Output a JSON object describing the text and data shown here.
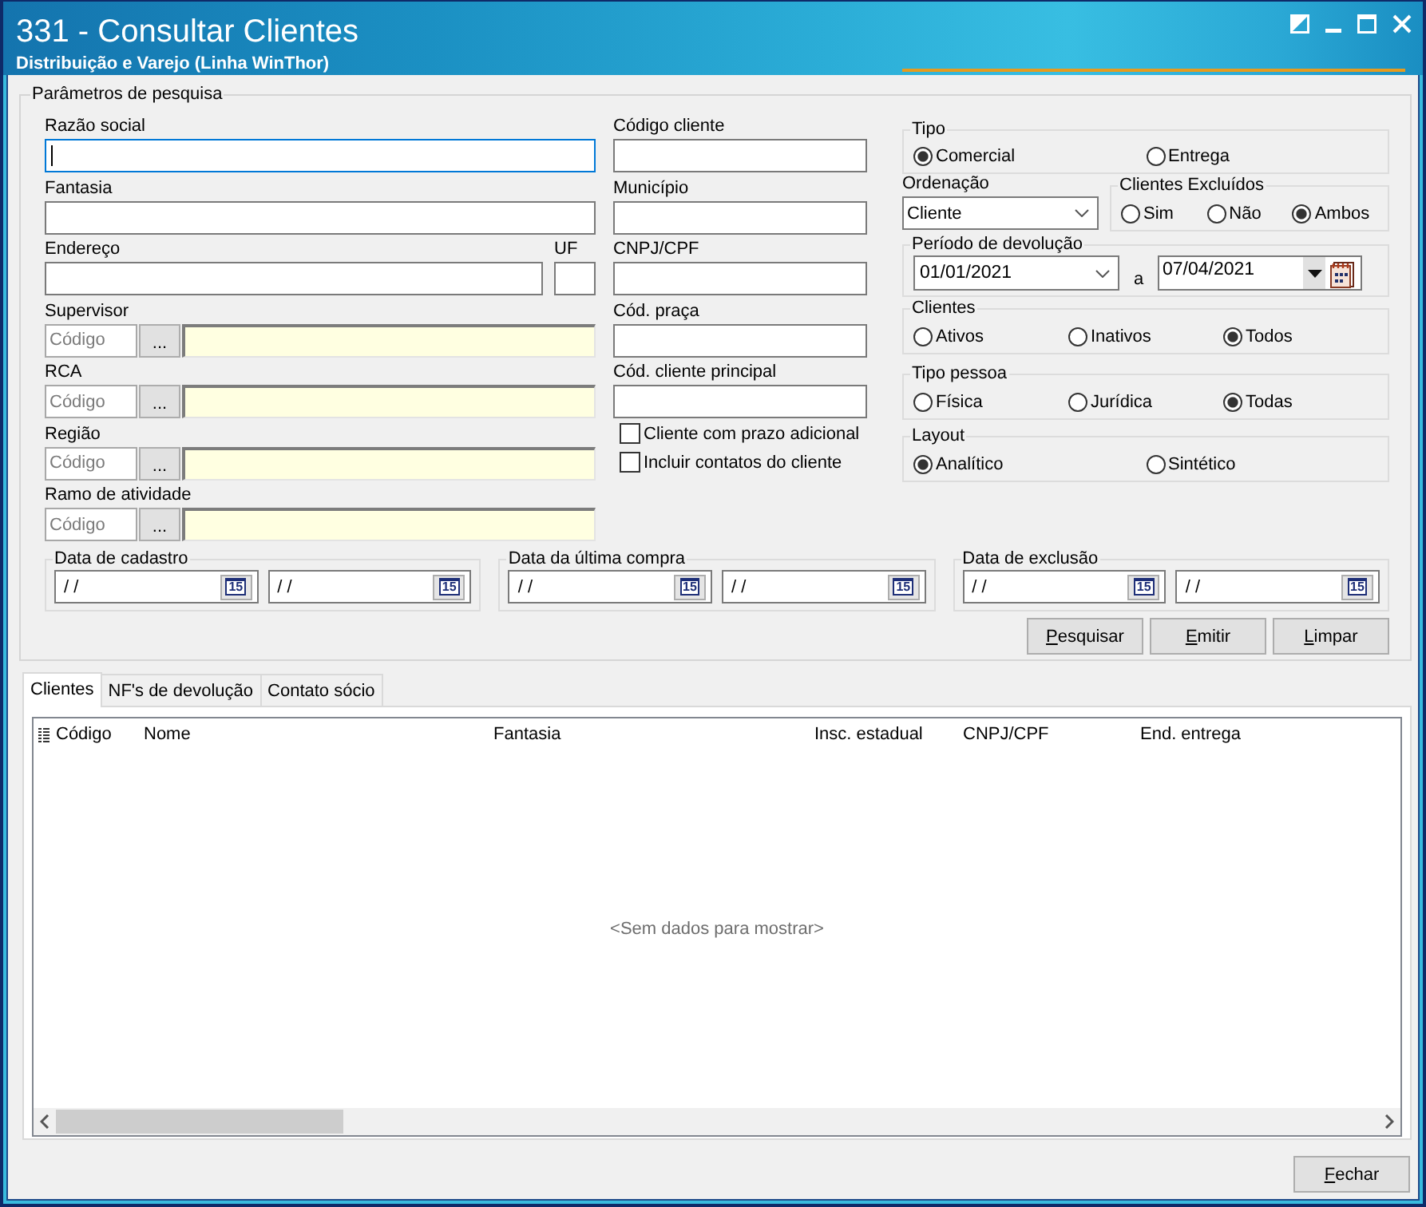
{
  "window": {
    "title": "331 - Consultar Clientes",
    "subtitle": "Distribuição e Varejo (Linha WinThor)"
  },
  "search_parameters": {
    "title": "Parâmetros de pesquisa",
    "text_fields": [
      {
        "label": "Razão social",
        "focused": true
      },
      {
        "label": "Fantasia",
        "focused": false
      }
    ],
    "address": {
      "label": "Endereço",
      "uf_label": "UF"
    },
    "lookups": [
      {
        "label": "Supervisor",
        "placeholder": "Código",
        "button": "..."
      },
      {
        "label": "RCA",
        "placeholder": "Código",
        "button": "..."
      },
      {
        "label": "Região",
        "placeholder": "Código",
        "button": "..."
      },
      {
        "label": "Ramo de atividade",
        "placeholder": "Código",
        "button": "..."
      }
    ],
    "code_fields": [
      {
        "label": "Código cliente"
      },
      {
        "label": "Município"
      },
      {
        "label": "CNPJ/CPF"
      },
      {
        "label": "Cód. praça"
      },
      {
        "label": "Cód. cliente principal"
      }
    ],
    "checkboxes": [
      {
        "label": "Cliente com prazo adicional",
        "checked": false
      },
      {
        "label": "Incluir contatos do cliente",
        "checked": false
      }
    ],
    "type": {
      "title": "Tipo",
      "options": [
        {
          "label": "Comercial",
          "selected": true
        },
        {
          "label": "Entrega",
          "selected": false
        }
      ]
    },
    "sort_order": {
      "label": "Ordenação",
      "value": "Cliente"
    },
    "excluded_clients": {
      "title": "Clientes Excluídos",
      "options": [
        {
          "label": "Sim",
          "selected": false
        },
        {
          "label": "Não",
          "selected": false
        },
        {
          "label": "Ambos",
          "selected": true
        }
      ]
    },
    "return_period": {
      "title": "Período de devolução",
      "from": "01/01/2021",
      "separator": "a",
      "to": "07/04/2021"
    },
    "clients": {
      "title": "Clientes",
      "options": [
        {
          "label": "Ativos",
          "selected": false
        },
        {
          "label": "Inativos",
          "selected": false
        },
        {
          "label": "Todos",
          "selected": true
        }
      ]
    },
    "person_type": {
      "title": "Tipo pessoa",
      "options": [
        {
          "label": "Física",
          "selected": false
        },
        {
          "label": "Jurídica",
          "selected": false
        },
        {
          "label": "Todas",
          "selected": true
        }
      ]
    },
    "layout": {
      "title": "Layout",
      "options": [
        {
          "label": "Analítico",
          "selected": true
        },
        {
          "label": "Sintético",
          "selected": false
        }
      ]
    },
    "date_ranges": [
      {
        "title": "Data de cadastro",
        "fields": [
          {
            "value": "/ /",
            "calendar": "15"
          },
          {
            "value": "/ /",
            "calendar": "15"
          }
        ]
      },
      {
        "title": "Data da última compra",
        "fields": [
          {
            "value": "/ /",
            "calendar": "15"
          },
          {
            "value": "/ /",
            "calendar": "15"
          }
        ]
      },
      {
        "title": "Data de exclusão",
        "fields": [
          {
            "value": "/ /",
            "calendar": "15"
          },
          {
            "value": "/ /",
            "calendar": "15"
          }
        ]
      }
    ],
    "buttons": [
      "Pesquisar",
      "Emitir",
      "Limpar"
    ]
  },
  "tabs": [
    {
      "label": "Clientes",
      "selected": true
    },
    {
      "label": "NF's de devolução",
      "selected": false
    },
    {
      "label": "Contato sócio",
      "selected": false
    }
  ],
  "table": {
    "columns": [
      "Código",
      "Nome",
      "Fantasia",
      "Insc. estadual",
      "CNPJ/CPF",
      "End. entrega"
    ],
    "empty_message": "<Sem dados para mostrar>"
  },
  "footer": {
    "buttons": [
      "Fechar"
    ]
  }
}
